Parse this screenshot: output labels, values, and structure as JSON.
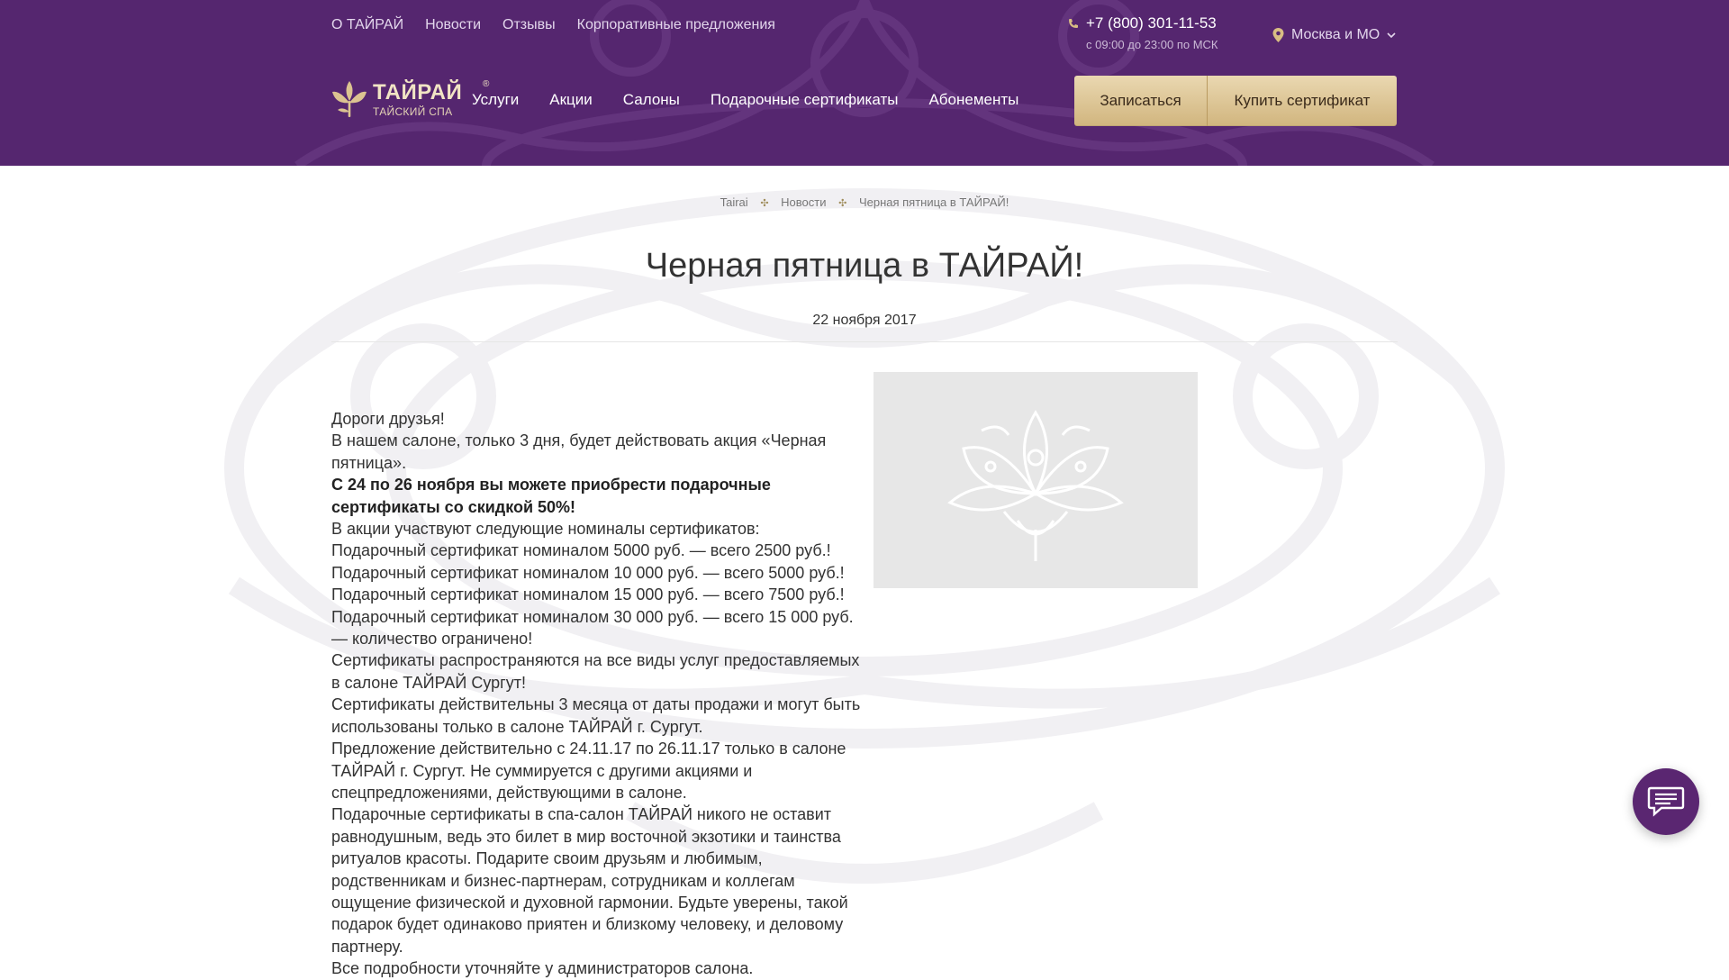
{
  "top_nav": [
    "О ТАЙРАЙ",
    "Новости",
    "Отзывы",
    "Корпоративные предложения"
  ],
  "phone": "+7 (800) 301-11-53",
  "phone_hours": "с 09:00 до 23:00 по МСК",
  "city": "Москва и МО",
  "logo": {
    "name": "ТАЙРАЙ",
    "subtitle": "ТАЙСКИЙ СПА",
    "reg": "®"
  },
  "main_nav": [
    "Услуги",
    "Акции",
    "Салоны",
    "Подарочные сертификаты",
    "Абонементы"
  ],
  "buttons": {
    "book": "Записаться",
    "buy": "Купить сертификат"
  },
  "breadcrumb": [
    "Tairai",
    "Новости",
    "Черная пятница в ТАЙРАЙ!"
  ],
  "title": "Черная пятница в ТАЙРАЙ!",
  "date": "22 ноября 2017",
  "article": [
    {
      "text": "Дороги друзья!",
      "bold": false
    },
    {
      "text": "В нашем салоне, только 3 дня, будет действовать акция «Черная пятница».",
      "bold": false
    },
    {
      "text": "С 24 по 26 ноября вы можете приобрести подарочные сертификаты со скидкой 50%!",
      "bold": true
    },
    {
      "text": "В акции участвуют следующие номиналы сертификатов:",
      "bold": false
    },
    {
      "text": "Подарочный сертификат номиналом 5000 руб. — всего 2500 руб.!",
      "bold": false
    },
    {
      "text": "Подарочный сертификат номиналом 10 000 руб. — всего 5000 руб.!",
      "bold": false
    },
    {
      "text": "Подарочный сертификат номиналом 15 000 руб. — всего 7500 руб.!",
      "bold": false
    },
    {
      "text": "Подарочный сертификат номиналом 30 000 руб. — всего 15 000 руб. — количество ограничено!",
      "bold": false
    },
    {
      "text": "Сертификаты распространяются на все виды услуг предоставляемых в салоне ТАЙРАЙ Сургут!",
      "bold": false
    },
    {
      "text": "Сертификаты действительны 3 месяца от даты продажи и могут быть использованы только в салоне ТАЙРАЙ г. Сургут.",
      "bold": false
    },
    {
      "text": "Предложение действительно с 24.11.17 по 26.11.17 только в салоне ТАЙРАЙ г. Сургут. Не суммируется с другими акциями и спецпредложениями, действующими в салоне.",
      "bold": false
    },
    {
      "text": "Подарочные сертификаты в спа-салон ТАЙРАЙ никого не оставит равнодушным, ведь это билет в мир восточной экзотики и таинства ритуалов красоты. Подарите своим друзьям и любимым, родственникам и бизнес-партнерам, сотрудникам и коллегам ощущение физической и духовной гармонии. Будьте уверены, такой подарок будет одинаково приятен и близкому человеку, и деловому партнеру.",
      "bold": false
    },
    {
      "text": "Все подробности уточняйте у администраторов салона.",
      "bold": false
    }
  ],
  "icons": [
    "phone-icon",
    "location-pin-icon",
    "chevron-down-icon",
    "lotus-logo-icon",
    "breadcrumb-separator-icon",
    "lotus-ornament-icon",
    "chat-icon"
  ],
  "colors": {
    "header_bg": "#55266f",
    "button_gold": "#dcc391",
    "chat_bg": "#5a2671",
    "image_placeholder": "#e7e7e7"
  }
}
